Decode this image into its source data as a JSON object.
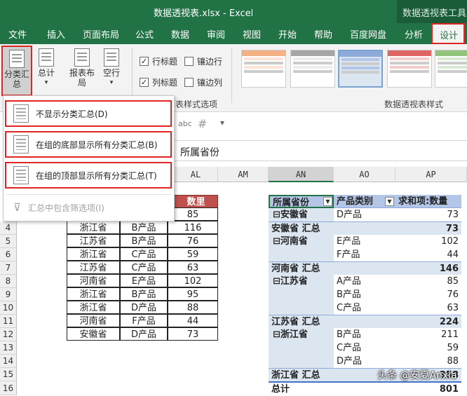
{
  "window": {
    "title": "数据透视表.xlsx  -  Excel",
    "context_title": "数据透视表工具"
  },
  "tabs": [
    "文件",
    "插入",
    "页面布局",
    "公式",
    "数据",
    "审阅",
    "视图",
    "开始",
    "帮助",
    "百度网盘",
    "分析",
    "设计"
  ],
  "ribbon": {
    "layout_buttons": {
      "subtotal": "分类汇\n总",
      "grand_total": "总计",
      "report_layout": "报表布\n局",
      "blank_rows": "空行"
    },
    "options": [
      {
        "label": "行标题",
        "checked": true
      },
      {
        "label": "镶边行",
        "checked": false
      },
      {
        "label": "列标题",
        "checked": true
      },
      {
        "label": "镶边列",
        "checked": false
      }
    ],
    "options_group_label": "表样式选项",
    "styles_group_label": "数据透视表样式"
  },
  "subtotal_menu": {
    "items": [
      "不显示分类汇总(D)",
      "在组的底部显示所有分类汇总(B)",
      "在组的顶部显示所有分类汇总(T)"
    ],
    "disabled_item": "汇总中包含筛选项(I)"
  },
  "formula_bar": {
    "content": "所属省份",
    "icon_text": "abc"
  },
  "columns": [
    "AL",
    "AM",
    "AN",
    "AO",
    "AP"
  ],
  "rows": [
    "4",
    "5",
    "6",
    "7",
    "8",
    "9",
    "10",
    "11",
    "12",
    "13",
    "14",
    "15",
    "16"
  ],
  "source_table": {
    "header_label": "数里",
    "rows": [
      [
        "",
        "",
        "85"
      ],
      [
        "浙江省",
        "B产品",
        "116"
      ],
      [
        "江苏省",
        "B产品",
        "76"
      ],
      [
        "浙江省",
        "C产品",
        "59"
      ],
      [
        "江苏省",
        "C产品",
        "63"
      ],
      [
        "河南省",
        "E产品",
        "102"
      ],
      [
        "浙江省",
        "B产品",
        "95"
      ],
      [
        "浙江省",
        "D产品",
        "88"
      ],
      [
        "河南省",
        "F产品",
        "44"
      ],
      [
        "安徽省",
        "D产品",
        "73"
      ]
    ]
  },
  "pivot": {
    "headers": [
      "所属省份",
      "产品类别",
      "求和项:数量"
    ],
    "rows": [
      {
        "kind": "item",
        "province": "⊟安徽省",
        "product": "D产品",
        "value": "73"
      },
      {
        "kind": "subtotal",
        "province": "安徽省 汇总",
        "product": "",
        "value": "73"
      },
      {
        "kind": "item",
        "province": "⊟河南省",
        "product": "E产品",
        "value": "102"
      },
      {
        "kind": "item",
        "province": "",
        "product": "F产品",
        "value": "44"
      },
      {
        "kind": "subtotal",
        "province": "河南省 汇总",
        "product": "",
        "value": "146"
      },
      {
        "kind": "item",
        "province": "⊟江苏省",
        "product": "A产品",
        "value": "85"
      },
      {
        "kind": "item",
        "province": "",
        "product": "B产品",
        "value": "76"
      },
      {
        "kind": "item",
        "province": "",
        "product": "C产品",
        "value": "63"
      },
      {
        "kind": "subtotal",
        "province": "江苏省 汇总",
        "product": "",
        "value": "224"
      },
      {
        "kind": "item",
        "province": "⊟浙江省",
        "product": "B产品",
        "value": "211"
      },
      {
        "kind": "item",
        "province": "",
        "product": "C产品",
        "value": "59"
      },
      {
        "kind": "item",
        "province": "",
        "product": "D产品",
        "value": "88"
      },
      {
        "kind": "subtotal",
        "province": "浙江省 汇总",
        "product": "",
        "value": "358"
      },
      {
        "kind": "total",
        "province": "总计",
        "product": "",
        "value": "801"
      }
    ]
  },
  "watermark": "头条 @安夏Anxia",
  "colors": {
    "excel_green": "#217346",
    "highlight_red": "#e02424",
    "pivot_header": "#b4c6e7",
    "pivot_band": "#dce6f1"
  }
}
